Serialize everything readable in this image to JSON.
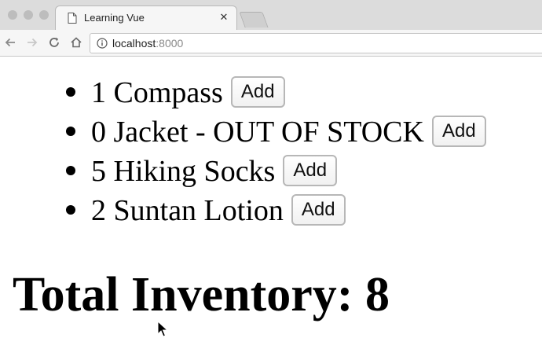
{
  "browser": {
    "tab": {
      "title": "Learning Vue"
    },
    "url": {
      "host": "localhost",
      "port": ":8000"
    }
  },
  "inventory": {
    "items": [
      {
        "label": "1 Compass",
        "button": "Add"
      },
      {
        "label": "0 Jacket - OUT OF STOCK",
        "button": "Add"
      },
      {
        "label": "5 Hiking Socks",
        "button": "Add"
      },
      {
        "label": "2 Suntan Lotion",
        "button": "Add"
      }
    ],
    "total_label": "Total Inventory: 8"
  },
  "icons": {
    "tab": "document-icon",
    "close": "close-icon",
    "back": "back-arrow-icon",
    "forward": "forward-arrow-icon",
    "reload": "reload-icon",
    "home": "home-icon",
    "info": "info-icon",
    "cursor": "mouse-cursor-icon"
  }
}
